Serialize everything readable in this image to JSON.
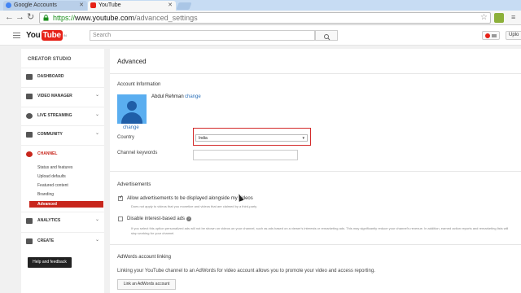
{
  "browser": {
    "tabs": [
      {
        "title": "Google Accounts",
        "icon": "google-icon"
      },
      {
        "title": "YouTube",
        "icon": "youtube-icon"
      }
    ],
    "url": {
      "scheme": "https://",
      "host": "www.youtube.com",
      "path": "/advanced_settings"
    }
  },
  "header": {
    "logo_you": "You",
    "logo_tube": "Tube",
    "logo_region": "IN",
    "search_placeholder": "Search",
    "upload_label": "Uplo"
  },
  "sidebar": {
    "title": "CREATOR STUDIO",
    "items": [
      {
        "label": "DASHBOARD",
        "icon": "dashboard-icon"
      },
      {
        "label": "VIDEO MANAGER",
        "icon": "video-manager-icon"
      },
      {
        "label": "LIVE STREAMING",
        "icon": "live-streaming-icon"
      },
      {
        "label": "COMMUNITY",
        "icon": "community-icon"
      },
      {
        "label": "CHANNEL",
        "icon": "channel-icon"
      },
      {
        "label": "ANALYTICS",
        "icon": "analytics-icon"
      },
      {
        "label": "CREATE",
        "icon": "create-icon"
      }
    ],
    "channel_subitems": [
      "Status and features",
      "Upload defaults",
      "Featured content",
      "Branding",
      "Advanced"
    ],
    "help_button": "Help and feedback"
  },
  "main": {
    "title": "Advanced",
    "account_info": {
      "header": "Account Information",
      "name": "Abdul Rehman",
      "change_name": "change",
      "change_avatar": "change",
      "country_label": "Country",
      "country_value": "India",
      "keywords_label": "Channel keywords",
      "keywords_value": ""
    },
    "advertisements": {
      "header": "Advertisements",
      "allow_ads_label": "Allow advertisements to be displayed alongside my videos",
      "allow_ads_checked": true,
      "allow_ads_note": "Does not apply to videos that you monetize and videos that are claimed by a third-party",
      "interest_ads_label": "Disable interest-based ads",
      "interest_ads_checked": false,
      "interest_ads_note": "If you select this option personalized ads will not be shown on videos on your channel, such as ads based on a viewer's interests or remarketing ads. This may significantly reduce your channel's revenue. In addition, earned action reports and remarketing lists will stop working for your channel."
    },
    "adwords": {
      "header": "AdWords account linking",
      "description": "Linking your YouTube channel to an AdWords for video account allows you to promote your video and access reporting.",
      "button": "Link an AdWords account"
    }
  },
  "colors": {
    "accent": "#e62117",
    "active_nav": "#c8261c",
    "link": "#2a6fb8",
    "highlight_box": "#d32a2a"
  }
}
